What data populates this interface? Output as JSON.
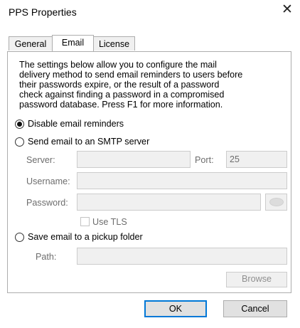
{
  "window": {
    "title": "PPS Properties",
    "close_glyph": "✕"
  },
  "tabs": [
    {
      "label": "General",
      "active": false
    },
    {
      "label": "Email",
      "active": true
    },
    {
      "label": "License",
      "active": false
    }
  ],
  "email": {
    "description_lines": [
      "The settings below allow you to configure the mail",
      "delivery method to send email reminders to users before",
      "their passwords expire, or the result of a password",
      "check against finding a password in a compromised",
      "password database. Press F1 for more information."
    ],
    "options": {
      "disable": {
        "label": "Disable email reminders",
        "checked": true
      },
      "smtp": {
        "label": "Send email to an SMTP server",
        "checked": false
      },
      "pickup": {
        "label": "Save email to a pickup folder",
        "checked": false
      }
    },
    "smtp": {
      "server_label": "Server:",
      "server_value": "",
      "port_label": "Port:",
      "port_value": "25",
      "username_label": "Username:",
      "username_value": "",
      "password_label": "Password:",
      "password_value": "",
      "show_password_icon": "eye-icon",
      "use_tls_label": "Use TLS",
      "use_tls_checked": false
    },
    "pickup": {
      "path_label": "Path:",
      "path_value": "",
      "browse_label": "Browse"
    }
  },
  "footer": {
    "ok_label": "OK",
    "cancel_label": "Cancel"
  }
}
